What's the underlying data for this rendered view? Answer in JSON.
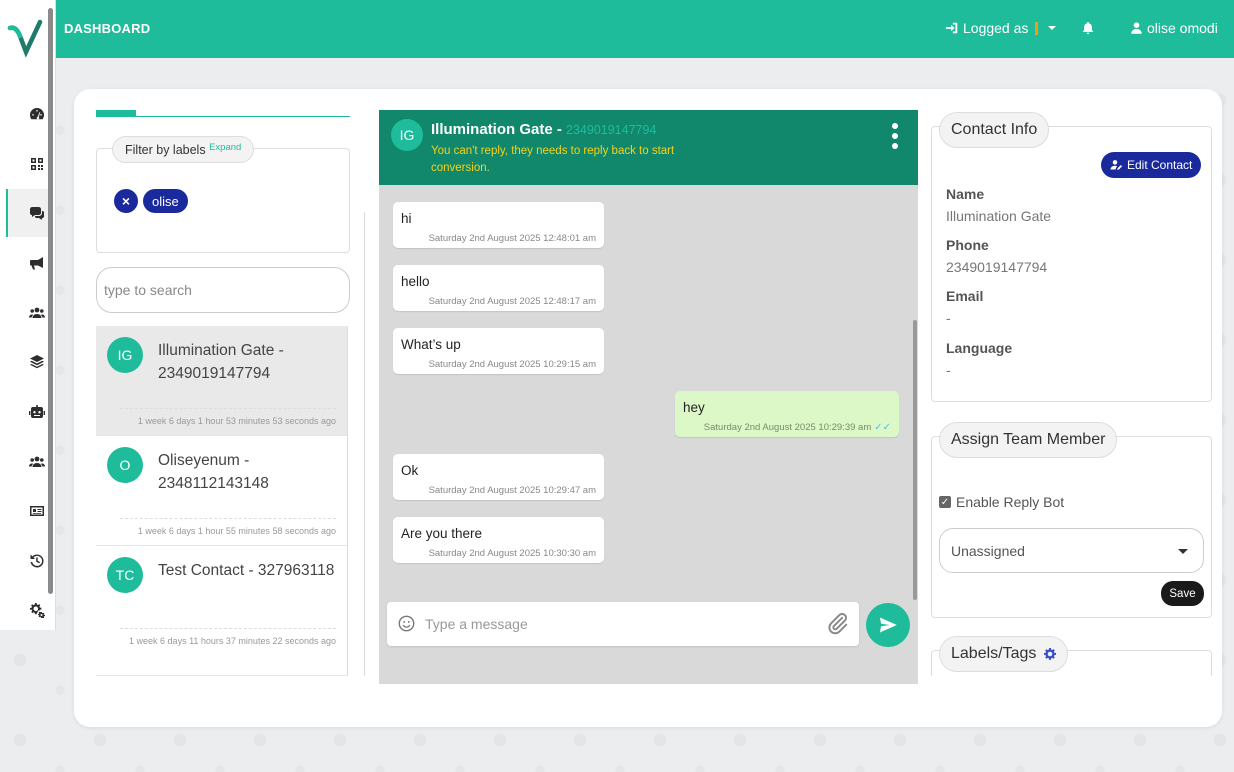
{
  "app": {
    "brand": "DASHBOARD",
    "logged_as_label": "Logged as",
    "user_name": "olise omodi",
    "accent_color": "#1fbc9c",
    "primary_color": "#1a2a9c"
  },
  "sidebar": {
    "icons": [
      "dashboard-icon",
      "qrcode-icon",
      "chat-icon",
      "megaphone-icon",
      "users-icon",
      "layers-icon",
      "robot-icon",
      "team-icon",
      "id-card-icon",
      "history-icon",
      "settings-icon"
    ],
    "active": "chat-icon"
  },
  "filters": {
    "title": "Filter by labels",
    "expand_label": "Expand",
    "selected_label": "olise"
  },
  "search": {
    "placeholder": "type to search"
  },
  "contacts": [
    {
      "initials": "IG",
      "name": "Illumination Gate - 2349019147794",
      "last_seen": "1 week 6 days 1 hour 53 minutes 53 seconds ago",
      "active": true
    },
    {
      "initials": "O",
      "name": "Oliseyenum - 2348112143148",
      "last_seen": "1 week 6 days 1 hour 55 minutes 58 seconds ago",
      "active": false
    },
    {
      "initials": "TC",
      "name": "Test Contact - 327963118",
      "last_seen": "1 week 6 days 11 hours 37 minutes 22 seconds ago",
      "active": false
    }
  ],
  "chat": {
    "initials": "IG",
    "name": "Illumination Gate -",
    "phone": "2349019147794",
    "note": "You can't reply, they needs to reply back to start conversion.",
    "messages": [
      {
        "direction": "in",
        "text": "hi",
        "time": "Saturday 2nd August 2025 12:48:01 am"
      },
      {
        "direction": "in",
        "text": "hello",
        "time": "Saturday 2nd August 2025 12:48:17 am"
      },
      {
        "direction": "in",
        "text": "What’s up",
        "time": "Saturday 2nd August 2025 10:29:15 am"
      },
      {
        "direction": "out",
        "text": "hey",
        "time": "Saturday 2nd August 2025 10:29:39 am"
      },
      {
        "direction": "in",
        "text": "Ok",
        "time": "Saturday 2nd August 2025 10:29:47 am"
      },
      {
        "direction": "in",
        "text": "Are you there",
        "time": "Saturday 2nd August 2025 10:30:30 am"
      }
    ],
    "composer_placeholder": "Type a message"
  },
  "contact_info": {
    "title": "Contact Info",
    "edit_label": "Edit Contact",
    "fields": [
      {
        "label": "Name",
        "value": "Illumination Gate"
      },
      {
        "label": "Phone",
        "value": "2349019147794"
      },
      {
        "label": "Email",
        "value": "-"
      },
      {
        "label": "Language",
        "value": "-"
      }
    ]
  },
  "assign": {
    "title": "Assign Team Member",
    "reply_bot_label": "Enable Reply Bot",
    "reply_bot_checked": true,
    "selected": "Unassigned",
    "save_label": "Save"
  },
  "labels_panel": {
    "title": "Labels/Tags"
  }
}
